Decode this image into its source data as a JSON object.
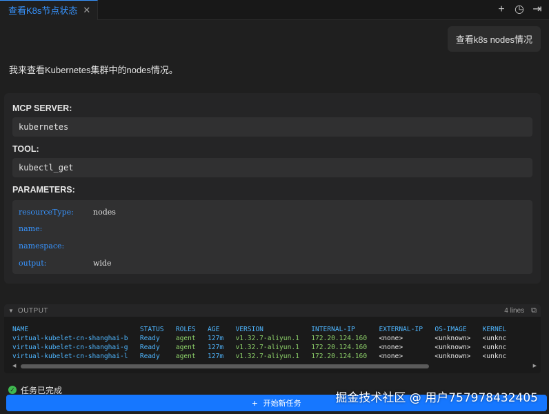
{
  "tab": {
    "label": "查看K8s节点状态",
    "close": "✕"
  },
  "tab_actions": {
    "add": "+",
    "history": "◷",
    "collapse": "⇥"
  },
  "user_message": "查看k8s nodes情况",
  "assistant_message": "我来查看Kubernetes集群中的nodes情况。",
  "tool_card": {
    "server_label": "MCP SERVER:",
    "server_value": "kubernetes",
    "tool_label": "TOOL:",
    "tool_value": "kubectl_get",
    "params_label": "PARAMETERS:",
    "params": [
      {
        "key": "resourceType:",
        "value": "nodes"
      },
      {
        "key": "name:",
        "value": ""
      },
      {
        "key": "namespace:",
        "value": ""
      },
      {
        "key": "output:",
        "value": "wide"
      }
    ]
  },
  "output": {
    "title": "OUTPUT",
    "line_count": "4 lines",
    "columns": [
      "NAME",
      "STATUS",
      "ROLES",
      "AGE",
      "VERSION",
      "INTERNAL-IP",
      "EXTERNAL-IP",
      "OS-IMAGE",
      "KERNEL"
    ],
    "rows": [
      [
        "virtual-kubelet-cn-shanghai-b",
        "Ready",
        "agent",
        "127m",
        "v1.32.7-aliyun.1",
        "172.20.124.160",
        "<none>",
        "<unknown>",
        "<unknc"
      ],
      [
        "virtual-kubelet-cn-shanghai-g",
        "Ready",
        "agent",
        "127m",
        "v1.32.7-aliyun.1",
        "172.20.124.160",
        "<none>",
        "<unknown>",
        "<unknc"
      ],
      [
        "virtual-kubelet-cn-shanghai-l",
        "Ready",
        "agent",
        "127m",
        "v1.32.7-aliyun.1",
        "172.20.124.160",
        "<none>",
        "<unknown>",
        "<unknc"
      ]
    ]
  },
  "status": {
    "text": "任务已完成",
    "icon": "check-icon"
  },
  "new_task": {
    "label": "开始新任务",
    "plus": "+"
  },
  "watermark": "掘金技术社区 @ 用户757978432405",
  "colors": {
    "accent": "#1677ff",
    "tab_accent": "#3794ff",
    "success": "#3fb950",
    "string_green": "#8ed26a"
  }
}
